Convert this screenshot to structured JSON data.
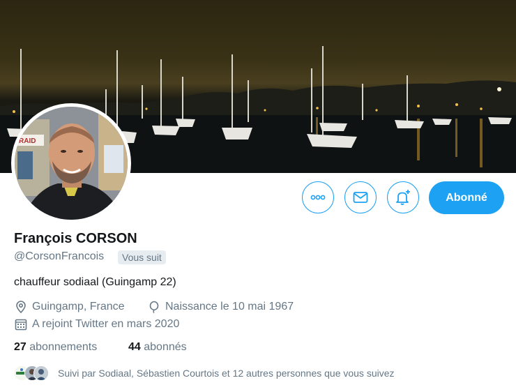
{
  "profile": {
    "name": "François CORSON",
    "handle": "@CorsonFrancois",
    "follows_you": "Vous suit",
    "bio": "chauffeur sodiaal (Guingamp 22)",
    "location": "Guingamp, France",
    "birthday": "Naissance le 10 mai 1967",
    "joined": "A rejoint Twitter en mars 2020",
    "storefront_sign": "RAID"
  },
  "stats": {
    "following_count": "27",
    "following_label": "abonnements",
    "followers_count": "44",
    "followers_label": "abonnés"
  },
  "followed_by": {
    "text": "Suivi par Sodiaal, Sébastien Courtois et 12 autres personnes que vous suivez",
    "avatar_1_label": "Sodiaal"
  },
  "actions": {
    "more_icon": "more-dots-icon",
    "message_icon": "envelope-icon",
    "notify_icon": "bell-plus-icon",
    "follow_label": "Abonné"
  },
  "colors": {
    "accent": "#1da1f2",
    "secondary_text": "#657786",
    "primary_text": "#14171a"
  }
}
